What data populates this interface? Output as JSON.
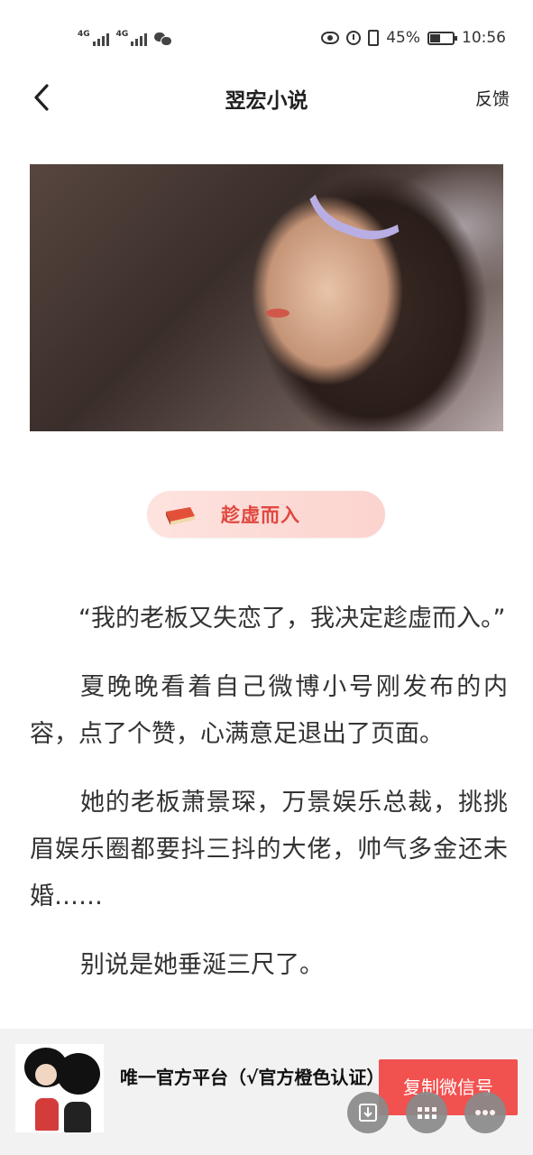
{
  "status_bar": {
    "signal1_label": "4G",
    "signal2_label": "4G",
    "battery_percent": "45%",
    "battery_level": 0.45,
    "time": "10:56"
  },
  "nav": {
    "title": "翌宏小说",
    "feedback_label": "反馈"
  },
  "chapter": {
    "title": "趁虚而入"
  },
  "article": {
    "paragraphs": [
      "“我的老板又失恋了，我决定趁虚而入。”",
      "夏晚晚看着自己微博小号刚发布的内容，点了个赞，心满意足退出了页面。",
      "她的老板萧景琛，万景娱乐总裁，挑挑眉娱乐圈都要抖三抖的大佬，帅气多金还未婚……",
      "别说是她垂涎三尺了。"
    ]
  },
  "promo": {
    "text": "唯一官方平台（√官方橙色认证）",
    "copy_button": "复制微信号"
  },
  "colors": {
    "accent_red": "#f1514f",
    "chapter_text": "#e0483f",
    "chapter_pill_bg": "#fde3df"
  }
}
